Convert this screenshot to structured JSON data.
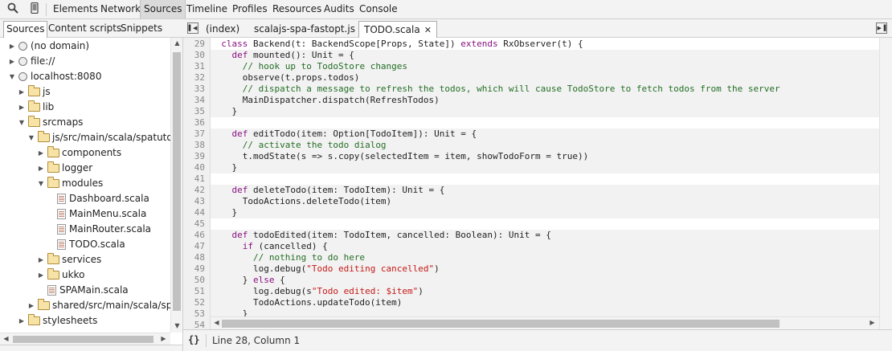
{
  "toolbar": {
    "tabs": [
      "Elements",
      "Network",
      "Sources",
      "Timeline",
      "Profiles",
      "Resources",
      "Audits",
      "Console"
    ],
    "active_tab": "Sources",
    "search_icon": "search-icon",
    "device_icon": "mobile-device-icon"
  },
  "navigator": {
    "tabs": [
      "Sources",
      "Content scripts",
      "Snippets"
    ],
    "active_tab": "Sources",
    "tree": [
      {
        "label": "(no domain)",
        "type": "domain",
        "depth": 0,
        "expanded": false
      },
      {
        "label": "file://",
        "type": "domain",
        "depth": 0,
        "expanded": false
      },
      {
        "label": "localhost:8080",
        "type": "domain",
        "depth": 0,
        "expanded": true
      },
      {
        "label": "js",
        "type": "folder",
        "depth": 1,
        "expanded": false
      },
      {
        "label": "lib",
        "type": "folder",
        "depth": 1,
        "expanded": false
      },
      {
        "label": "srcmaps",
        "type": "folder",
        "depth": 1,
        "expanded": true
      },
      {
        "label": "js/src/main/scala/spatutorial",
        "type": "folder",
        "depth": 2,
        "expanded": true
      },
      {
        "label": "components",
        "type": "folder",
        "depth": 3,
        "expanded": false
      },
      {
        "label": "logger",
        "type": "folder",
        "depth": 3,
        "expanded": false
      },
      {
        "label": "modules",
        "type": "folder",
        "depth": 3,
        "expanded": true
      },
      {
        "label": "Dashboard.scala",
        "type": "file",
        "depth": 4
      },
      {
        "label": "MainMenu.scala",
        "type": "file",
        "depth": 4
      },
      {
        "label": "MainRouter.scala",
        "type": "file",
        "depth": 4
      },
      {
        "label": "TODO.scala",
        "type": "file",
        "depth": 4
      },
      {
        "label": "services",
        "type": "folder",
        "depth": 3,
        "expanded": false
      },
      {
        "label": "ukko",
        "type": "folder",
        "depth": 3,
        "expanded": false
      },
      {
        "label": "SPAMain.scala",
        "type": "file",
        "depth": 3
      },
      {
        "label": "shared/src/main/scala/spatutorial",
        "type": "folder",
        "depth": 2,
        "expanded": false
      },
      {
        "label": "stylesheets",
        "type": "folder",
        "depth": 1,
        "expanded": false
      }
    ]
  },
  "editor": {
    "tabs": [
      {
        "label": "(index)",
        "active": false,
        "closable": false
      },
      {
        "label": "scalajs-spa-fastopt.js",
        "active": false,
        "closable": false
      },
      {
        "label": "TODO.scala",
        "active": true,
        "closable": true
      }
    ],
    "close_glyph": "✕",
    "lines": [
      {
        "n": "29",
        "tokens": [
          [
            "pl",
            "  "
          ],
          [
            "kw",
            "class"
          ],
          [
            "pl",
            " Backend(t: BackendScope[Props, State]) "
          ],
          [
            "kw",
            "extends"
          ],
          [
            "pl",
            " RxObserver(t) {"
          ]
        ]
      },
      {
        "n": "30",
        "tokens": [
          [
            "pl",
            "    "
          ],
          [
            "kw",
            "def"
          ],
          [
            "pl",
            " mounted(): Unit = {"
          ]
        ]
      },
      {
        "n": "31",
        "tokens": [
          [
            "pl",
            "      "
          ],
          [
            "cm",
            "// hook up to TodoStore changes"
          ]
        ]
      },
      {
        "n": "32",
        "tokens": [
          [
            "pl",
            "      observe(t.props.todos)"
          ]
        ]
      },
      {
        "n": "33",
        "tokens": [
          [
            "pl",
            "      "
          ],
          [
            "cm",
            "// dispatch a message to refresh the todos, which will cause TodoStore to fetch todos from the server"
          ]
        ]
      },
      {
        "n": "34",
        "tokens": [
          [
            "pl",
            "      MainDispatcher.dispatch(RefreshTodos)"
          ]
        ]
      },
      {
        "n": "35",
        "tokens": [
          [
            "pl",
            "    }"
          ]
        ]
      },
      {
        "n": "36",
        "tokens": [
          [
            "pl",
            ""
          ]
        ]
      },
      {
        "n": "37",
        "tokens": [
          [
            "pl",
            "    "
          ],
          [
            "kw",
            "def"
          ],
          [
            "pl",
            " editTodo(item: Option[TodoItem]): Unit = {"
          ]
        ]
      },
      {
        "n": "38",
        "tokens": [
          [
            "pl",
            "      "
          ],
          [
            "cm",
            "// activate the todo dialog"
          ]
        ]
      },
      {
        "n": "39",
        "tokens": [
          [
            "pl",
            "      t.modState(s => s.copy(selectedItem = item, showTodoForm = true))"
          ]
        ]
      },
      {
        "n": "40",
        "tokens": [
          [
            "pl",
            "    }"
          ]
        ]
      },
      {
        "n": "41",
        "tokens": [
          [
            "pl",
            ""
          ]
        ]
      },
      {
        "n": "42",
        "tokens": [
          [
            "pl",
            "    "
          ],
          [
            "kw",
            "def"
          ],
          [
            "pl",
            " deleteTodo(item: TodoItem): Unit = {"
          ]
        ]
      },
      {
        "n": "43",
        "tokens": [
          [
            "pl",
            "      TodoActions.deleteTodo(item)"
          ]
        ]
      },
      {
        "n": "44",
        "tokens": [
          [
            "pl",
            "    }"
          ]
        ]
      },
      {
        "n": "45",
        "tokens": [
          [
            "pl",
            ""
          ]
        ]
      },
      {
        "n": "46",
        "tokens": [
          [
            "pl",
            "    "
          ],
          [
            "kw",
            "def"
          ],
          [
            "pl",
            " todoEdited(item: TodoItem, cancelled: Boolean): Unit = {"
          ]
        ]
      },
      {
        "n": "47",
        "tokens": [
          [
            "pl",
            "      "
          ],
          [
            "kw",
            "if"
          ],
          [
            "pl",
            " (cancelled) {"
          ]
        ]
      },
      {
        "n": "48",
        "tokens": [
          [
            "pl",
            "        "
          ],
          [
            "cm",
            "// nothing to do here"
          ]
        ]
      },
      {
        "n": "49",
        "tokens": [
          [
            "pl",
            "        log.debug("
          ],
          [
            "st",
            "\"Todo editing cancelled\""
          ],
          [
            "pl",
            ")"
          ]
        ]
      },
      {
        "n": "50",
        "tokens": [
          [
            "pl",
            "      } "
          ],
          [
            "kw",
            "else"
          ],
          [
            "pl",
            " {"
          ]
        ]
      },
      {
        "n": "51",
        "tokens": [
          [
            "pl",
            "        log.debug(s"
          ],
          [
            "st",
            "\"Todo edited: $item\""
          ],
          [
            "pl",
            ")"
          ]
        ]
      },
      {
        "n": "52",
        "tokens": [
          [
            "pl",
            "        TodoActions.updateTodo(item)"
          ]
        ]
      },
      {
        "n": "53",
        "tokens": [
          [
            "pl",
            "      }"
          ]
        ]
      },
      {
        "n": "54",
        "tokens": [
          [
            "pl",
            ""
          ]
        ]
      }
    ],
    "shaded_lines": [
      "30",
      "31",
      "32",
      "33",
      "34",
      "35",
      "37",
      "38",
      "39",
      "40",
      "42",
      "43",
      "44",
      "46",
      "47",
      "48",
      "49",
      "50",
      "51",
      "52",
      "53"
    ]
  },
  "status": {
    "format_button": "{}",
    "cursor_position": "Line 28, Column 1"
  },
  "colors": {
    "keyword": "#881280",
    "comment": "#236e25",
    "string": "#c41a16",
    "shaded_block": "#f2f2f2"
  }
}
